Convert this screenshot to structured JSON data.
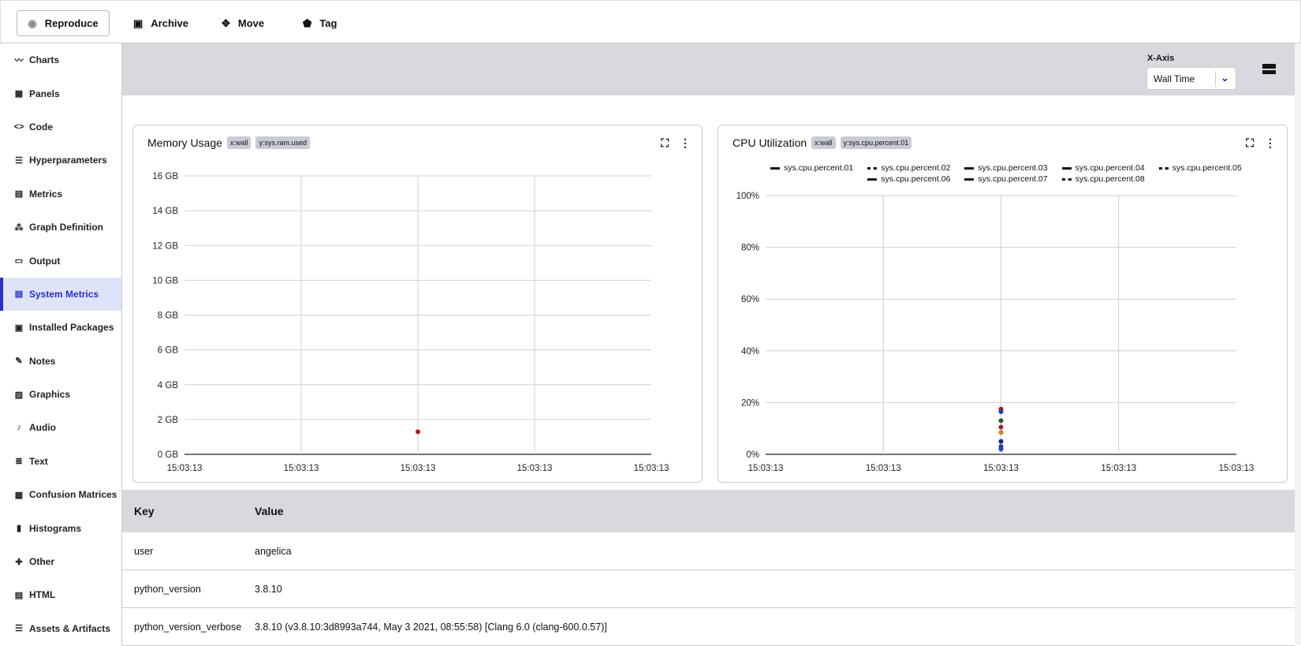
{
  "toolbar": {
    "reproduce": "Reproduce",
    "archive": "Archive",
    "move": "Move",
    "tag": "Tag"
  },
  "sidebar": {
    "items": [
      {
        "label": "Charts",
        "icon": "chart-line-icon",
        "glyph": "〰"
      },
      {
        "label": "Panels",
        "icon": "panels-icon",
        "glyph": "▦"
      },
      {
        "label": "Code",
        "icon": "code-icon",
        "glyph": "<>"
      },
      {
        "label": "Hyperparameters",
        "icon": "list-icon",
        "glyph": "☰"
      },
      {
        "label": "Metrics",
        "icon": "metrics-icon",
        "glyph": "▤"
      },
      {
        "label": "Graph Definition",
        "icon": "graph-icon",
        "glyph": "⁂"
      },
      {
        "label": "Output",
        "icon": "laptop-icon",
        "glyph": "▭"
      },
      {
        "label": "System Metrics",
        "icon": "server-icon",
        "glyph": "▤"
      },
      {
        "label": "Installed Packages",
        "icon": "briefcase-icon",
        "glyph": "▣"
      },
      {
        "label": "Notes",
        "icon": "pencil-icon",
        "glyph": "✎"
      },
      {
        "label": "Graphics",
        "icon": "image-icon",
        "glyph": "▨"
      },
      {
        "label": "Audio",
        "icon": "music-note-icon",
        "glyph": "♪"
      },
      {
        "label": "Text",
        "icon": "text-icon",
        "glyph": "≣"
      },
      {
        "label": "Confusion Matrices",
        "icon": "grid-icon",
        "glyph": "▦"
      },
      {
        "label": "Histograms",
        "icon": "bar-chart-icon",
        "glyph": "▮"
      },
      {
        "label": "Other",
        "icon": "puzzle-icon",
        "glyph": "✚"
      },
      {
        "label": "HTML",
        "icon": "html-icon",
        "glyph": "▤"
      },
      {
        "label": "Assets & Artifacts",
        "icon": "list-icon",
        "glyph": "☰"
      }
    ],
    "active": "System Metrics"
  },
  "controls": {
    "xaxis_label": "X-Axis",
    "xaxis_value": "Wall Time"
  },
  "accent": "#2531c9",
  "chart_data": [
    {
      "type": "scatter",
      "title": "Memory Usage",
      "chips": [
        "x:wall",
        "y:sys.ram.used"
      ],
      "yticks": [
        "0 GB",
        "2 GB",
        "4 GB",
        "6 GB",
        "8 GB",
        "10 GB",
        "12 GB",
        "14 GB",
        "16 GB"
      ],
      "ylim": [
        0,
        16
      ],
      "xticks": [
        "15:03:13",
        "15:03:13",
        "15:03:13",
        "15:03:13",
        "15:03:13"
      ],
      "grid": true,
      "series": [
        {
          "name": "sys.ram.used",
          "color": "#c0141b",
          "points": [
            [
              2,
              1.3
            ]
          ]
        }
      ]
    },
    {
      "type": "scatter",
      "title": "CPU Utilization",
      "chips": [
        "x:wall",
        "y:sys.cpu.percent.01"
      ],
      "yticks": [
        "0%",
        "20%",
        "40%",
        "60%",
        "80%",
        "100%"
      ],
      "ylim": [
        0,
        100
      ],
      "xticks": [
        "15:03:13",
        "15:03:13",
        "15:03:13",
        "15:03:13",
        "15:03:13"
      ],
      "grid": true,
      "legend": "top",
      "series": [
        {
          "name": "sys.cpu.percent.01",
          "color": "#c0141b",
          "points": [
            [
              2,
              17.5
            ]
          ]
        },
        {
          "name": "sys.cpu.percent.02",
          "color": "#1f3fb0",
          "points": [
            [
              2,
              16.5
            ]
          ]
        },
        {
          "name": "sys.cpu.percent.03",
          "color": "#1d5e2e",
          "points": [
            [
              2,
              13
            ]
          ]
        },
        {
          "name": "sys.cpu.percent.04",
          "color": "#a01e2a",
          "points": [
            [
              2,
              10.5
            ]
          ]
        },
        {
          "name": "sys.cpu.percent.05",
          "color": "#e07a16",
          "points": [
            [
              2,
              8.5
            ]
          ]
        },
        {
          "name": "sys.cpu.percent.06",
          "color": "#1a237e",
          "points": [
            [
              2,
              5
            ]
          ]
        },
        {
          "name": "sys.cpu.percent.07",
          "color": "#283593",
          "points": [
            [
              2,
              3
            ]
          ]
        },
        {
          "name": "sys.cpu.percent.08",
          "color": "#1e44d0",
          "points": [
            [
              2,
              2
            ]
          ]
        }
      ]
    }
  ],
  "table": {
    "headers": [
      "Key",
      "Value"
    ],
    "rows": [
      [
        "user",
        "angelica"
      ],
      [
        "python_version",
        "3.8.10"
      ],
      [
        "python_version_verbose",
        "3.8.10 (v3.8.10:3d8993a744, May 3 2021, 08:55:58) [Clang 6.0 (clang-600.0.57)]"
      ]
    ]
  }
}
